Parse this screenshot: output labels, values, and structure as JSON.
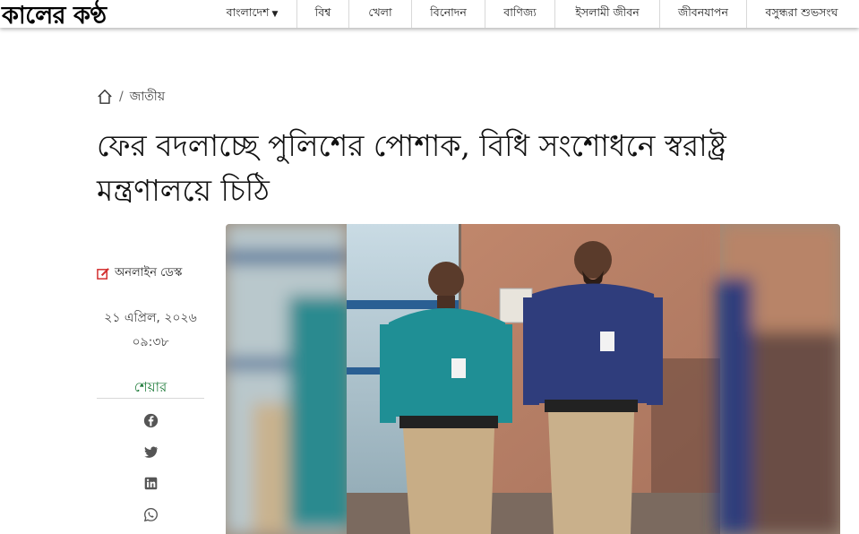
{
  "site": {
    "logo_text": "কালের কণ্ঠ"
  },
  "nav": {
    "items": [
      {
        "label": "বাংলাদেশ",
        "has_dropdown": true
      },
      {
        "label": "বিশ্ব"
      },
      {
        "label": "খেলা"
      },
      {
        "label": "বিনোদন"
      },
      {
        "label": "বাণিজ্য"
      },
      {
        "label": "ইসলামী জীবন"
      },
      {
        "label": "জীবনযাপন"
      },
      {
        "label": "বসুন্ধরা শুভসংঘ"
      }
    ]
  },
  "breadcrumb": {
    "separator": "/",
    "category": "জাতীয়"
  },
  "article": {
    "title": "ফের বদলাচ্ছে পুলিশের পোশাক, বিধি সংশোধনে স্বরাষ্ট্র মন্ত্রণালয়ে চিঠি",
    "author": "অনলাইন ডেস্ক",
    "date": "২১ এপ্রিল, ২০২৬",
    "time": "০৯:৩৮"
  },
  "share": {
    "label": "শেয়ার",
    "icons": [
      "facebook-icon",
      "twitter-icon",
      "linkedin-icon",
      "whatsapp-icon"
    ]
  },
  "colors": {
    "share_label": "#1e7b3a",
    "edit_icon": "#d32f2f",
    "share_icon": "#555555"
  }
}
